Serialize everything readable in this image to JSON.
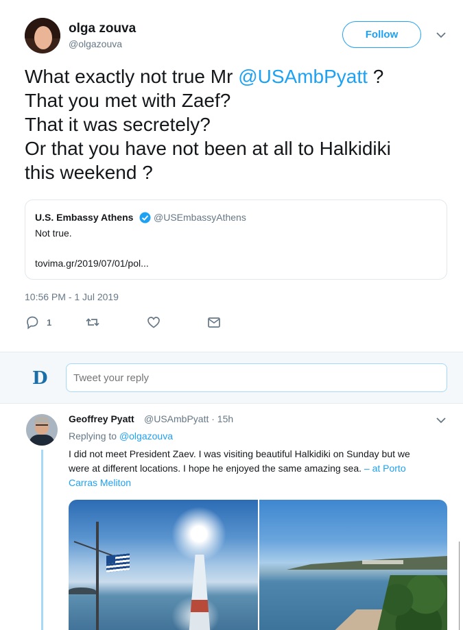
{
  "main_tweet": {
    "author_name": "olga zouva",
    "author_handle": "@olgazouva",
    "follow_label": "Follow",
    "text_lines": [
      [
        "What exactly not true Mr ",
        "@USAmbPyatt",
        " ?"
      ],
      [
        "That you met with Zaef?"
      ],
      [
        "That it was secretely?"
      ],
      [
        "Or that you have not been at all to Halkidiki"
      ],
      [
        "this weekend ?"
      ]
    ],
    "quote": {
      "name": "U.S. Embassy Athens",
      "handle": "@USEmbassyAthens",
      "text": "Not true.",
      "link": "tovima.gr/2019/07/01/pol..."
    },
    "timestamp": "10:56 PM - 1 Jul 2019",
    "actions": {
      "reply_count": "1"
    }
  },
  "reply_bar": {
    "logo_letter": "D",
    "placeholder": "Tweet your reply"
  },
  "reply": {
    "author_name": "Geoffrey Pyatt",
    "author_handle_time": "@USAmbPyatt · 15h",
    "replying_prefix": "Replying to ",
    "replying_to": "@olgazouva",
    "text_lines": [
      "I did not meet President Zaev.  I was visiting beautiful Halkidiki on Sunday but we",
      "were at different locations.  I hope he enjoyed the same amazing sea."
    ],
    "location_part1": " – at Porto",
    "location_part2": "Carras Meliton"
  },
  "colors": {
    "accent": "#1da1f2",
    "text": "#14171a",
    "secondary": "#657786",
    "border": "#e1e8ed"
  }
}
